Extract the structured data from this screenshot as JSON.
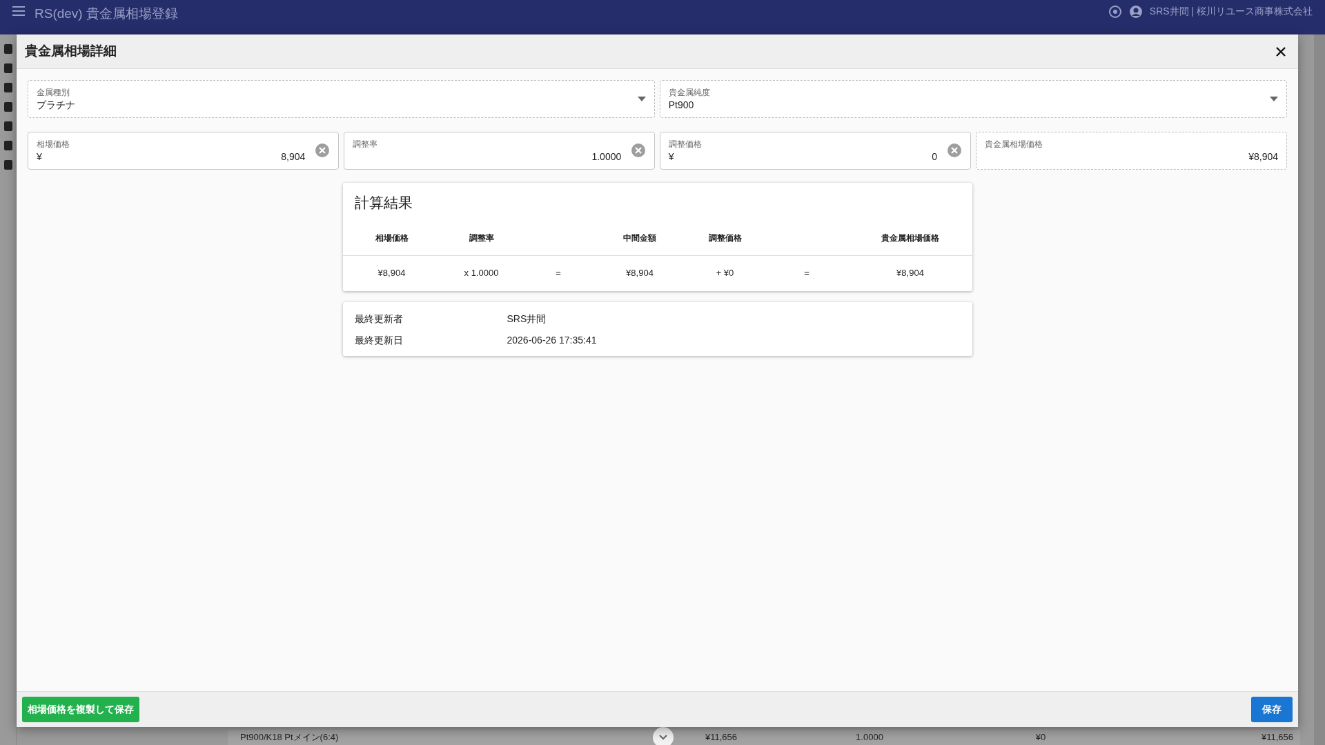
{
  "app_bar": {
    "title": "RS(dev) 貴金属相場登録",
    "user": "SRS井間 | 桜川リユース商事株式会社"
  },
  "background_row": {
    "cells": [
      "Pt900/K18 Ptメイン(6:4)",
      "¥11,656",
      "1.0000",
      "¥0",
      "¥11,656"
    ]
  },
  "dialog": {
    "title": "貴金属相場詳細",
    "selects": [
      {
        "label": "金属種別",
        "value": "プラチナ"
      },
      {
        "label": "貴金属純度",
        "value": "Pt900"
      }
    ],
    "fields": [
      {
        "kind": "input",
        "label": "相場価格",
        "prefix": "¥",
        "value": "8,904"
      },
      {
        "kind": "input",
        "label": "調整率",
        "value": "1.0000"
      },
      {
        "kind": "input",
        "label": "調整価格",
        "prefix": "¥",
        "value": "0"
      },
      {
        "kind": "readonly",
        "label": "貴金属相場価格",
        "value": "¥8,904"
      }
    ],
    "result": {
      "title": "計算結果",
      "columns": [
        {
          "header": "相場価格",
          "value": "¥8,904"
        },
        {
          "header": "調整率",
          "value": "x 1.0000"
        },
        {
          "value": "="
        },
        {
          "header": "中間金額",
          "value": "¥8,904"
        },
        {
          "header": "調整価格",
          "value": "+ ¥0"
        },
        {
          "value": "="
        },
        {
          "header": "貴金属相場価格",
          "value": "¥8,904"
        }
      ]
    },
    "info": [
      {
        "label": "最終更新者",
        "value": "SRS井間"
      },
      {
        "label": "最終更新日",
        "value": "2026-06-26 17:35:41"
      }
    ],
    "buttons": [
      {
        "kind": "copy",
        "label": "相場価格を複製して保存"
      },
      {
        "kind": "save",
        "label": "保存"
      }
    ]
  }
}
